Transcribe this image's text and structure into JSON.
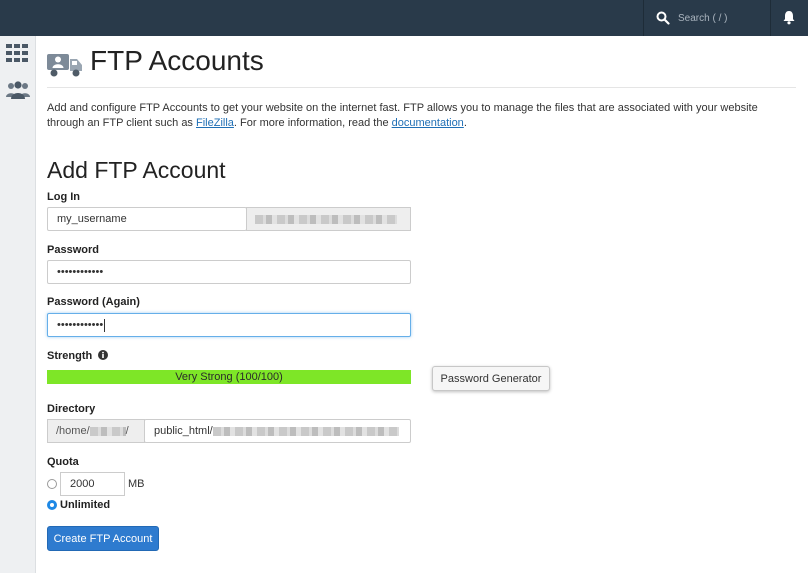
{
  "topbar": {
    "search_placeholder": "Search ( / )",
    "search_icon": "search-icon",
    "bell_icon": "bell-icon"
  },
  "sidebar": {
    "items": [
      {
        "icon": "apps-grid-icon"
      },
      {
        "icon": "users-icon"
      }
    ]
  },
  "header": {
    "icon": "ftp-truck-icon",
    "title": "FTP Accounts"
  },
  "description": {
    "text_before": "Add and configure FTP Accounts to get your website on the internet fast. FTP allows you to manage the files that are associated with your website through an FTP client such as ",
    "filezilla_link": "FileZilla",
    "text_middle": ". For more information, read the ",
    "documentation_link": "documentation",
    "text_after": "."
  },
  "form": {
    "section_title": "Add FTP Account",
    "login": {
      "label": "Log In",
      "value": "my_username"
    },
    "password": {
      "label": "Password",
      "value": "••••••••••••"
    },
    "password_again": {
      "label": "Password (Again)",
      "value": "••••••••••••"
    },
    "strength": {
      "label": "Strength",
      "bar_text": "Very Strong (100/100)",
      "score": 100,
      "info_icon": "info-icon"
    },
    "password_generator_label": "Password Generator",
    "directory": {
      "label": "Directory",
      "prefix": "/home/",
      "prefix_suffix": "/",
      "value": "public_html/"
    },
    "quota": {
      "label": "Quota",
      "value": "2000",
      "unit": "MB",
      "unlimited_label": "Unlimited",
      "selected": "unlimited"
    },
    "submit_label": "Create FTP Account"
  },
  "colors": {
    "topbar": "#293a4a",
    "strength_bar": "#7ee627",
    "primary_button": "#2e7bcf",
    "link": "#1f6fb5"
  }
}
